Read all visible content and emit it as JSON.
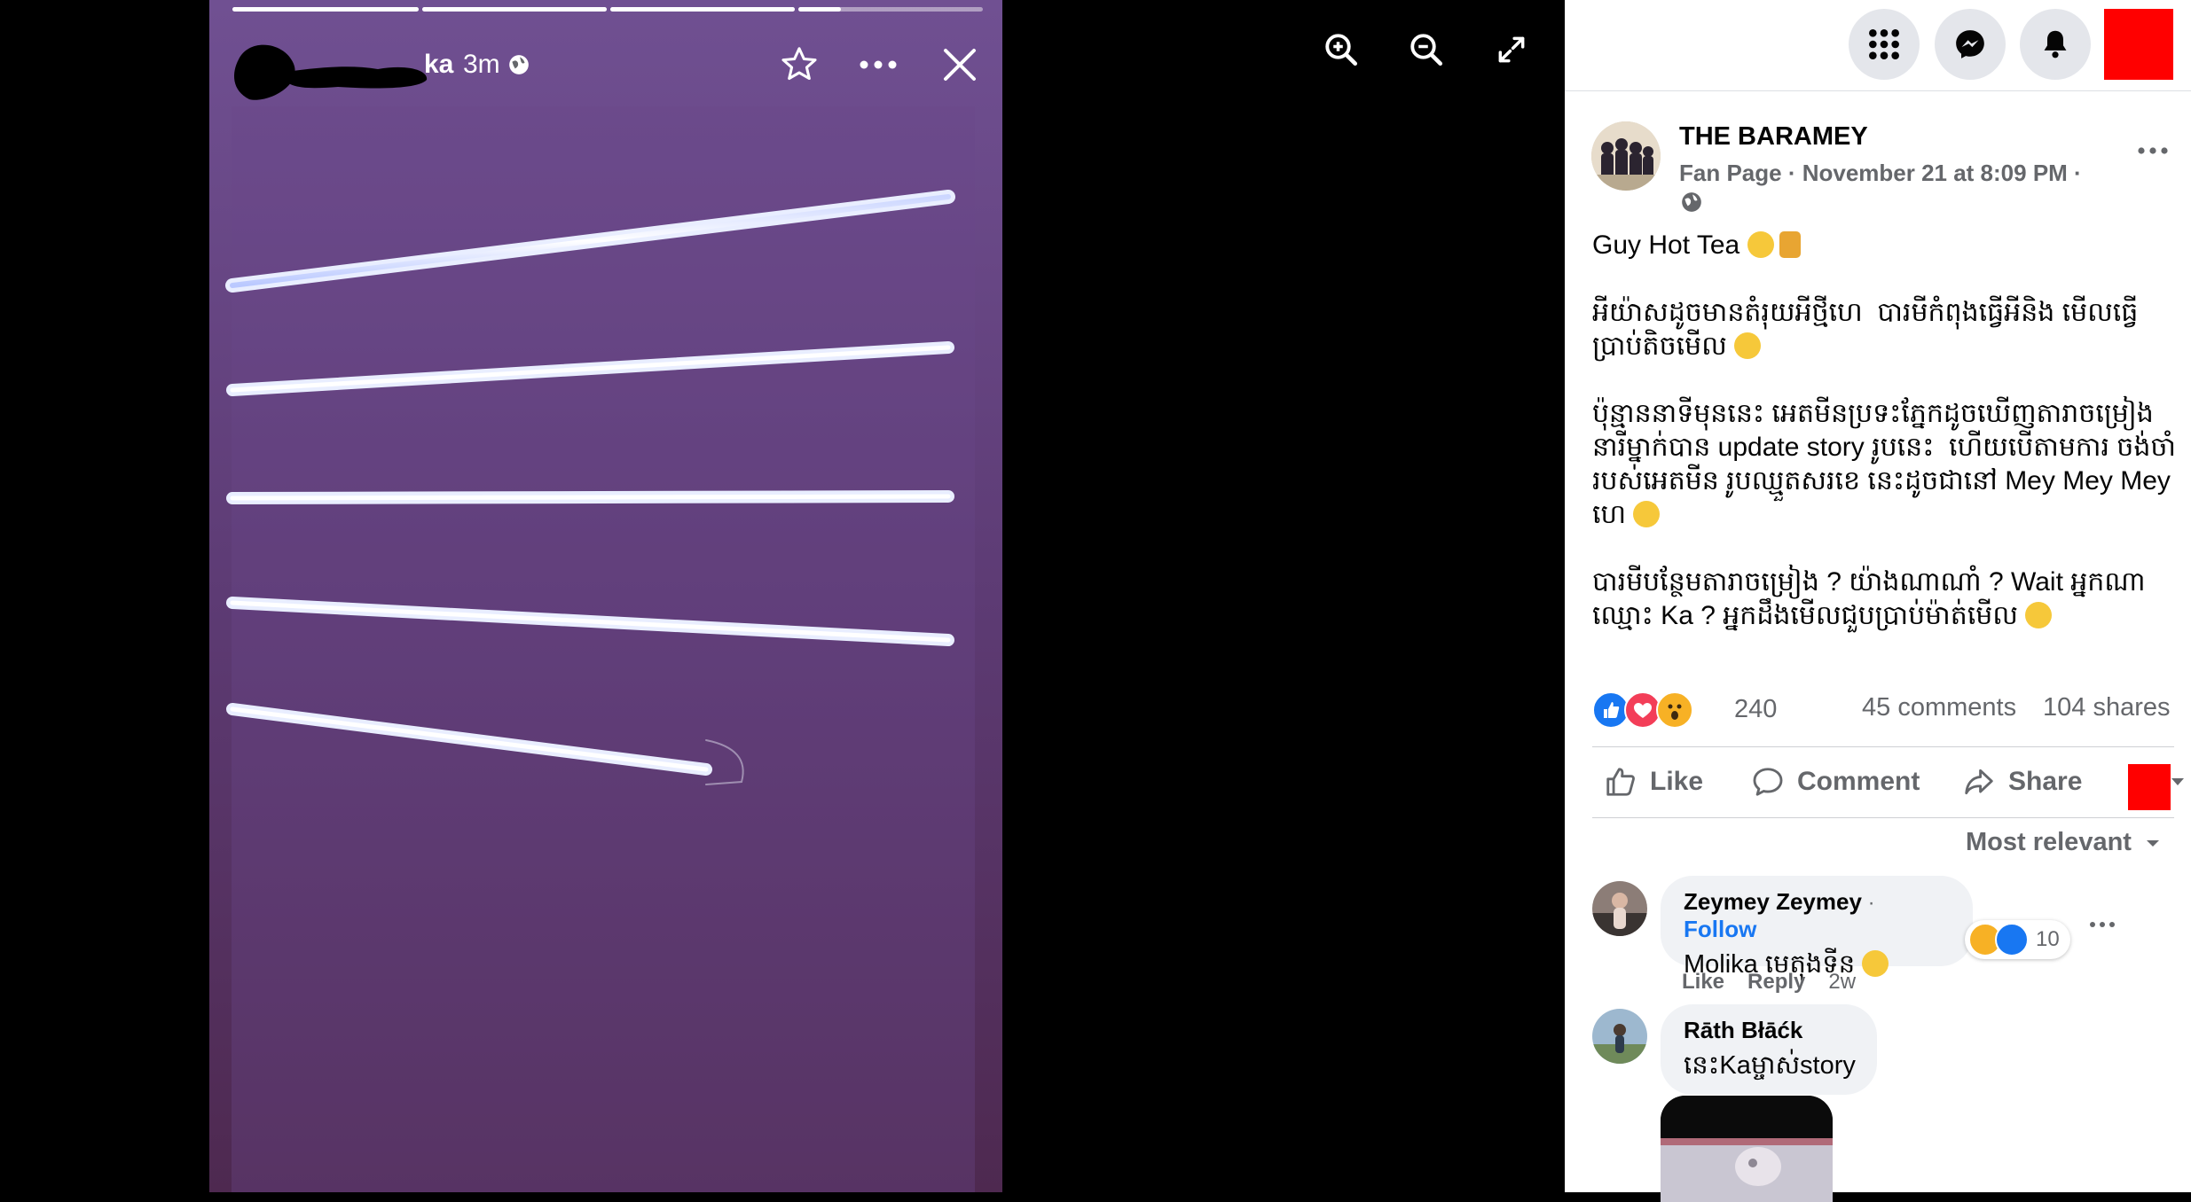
{
  "story": {
    "author": "ka",
    "time": "3m",
    "progress": [
      1,
      1,
      1,
      0.23,
      0
    ]
  },
  "viewer_tools": [
    "zoom-in",
    "zoom-out",
    "fullscreen"
  ],
  "post": {
    "page_name": "THE BARAMEY",
    "page_meta": "Fan Page · November 21 at 8:09 PM ·",
    "paragraphs": [
      "Guy Hot Tea",
      "អីយ៉ាសដូចមានតំរុយអីថ្មីហេ  បារមីកំពុងធ្វើអីនិង មើលធ្វើ ប្រាប់តិចមើល",
      "ប៉ុន្មាននាទីមុននេះ អេតមីនប្រទះភ្នែកដូចឃើញតារាចម្រៀង នារីម្នាក់បាន update story រូបនេះ  ហើយបើតាមការ ចង់ចាំរបស់អេតមីន រូបឈ្មួតសរខេ នេះដូចជានៅ Mey Mey Mey ហេ",
      "បារមីបន្ថែមតារាចម្រៀង ? យ៉ាងណាណាំ ? Wait អ្នកណា ឈ្មោះ Ka ? អ្នកដឹងមើលជួបប្រាប់ម៉ាត់មើល"
    ],
    "reaction_count": "240",
    "comments_count": "45 comments",
    "shares_count": "104 shares",
    "actions": {
      "like": "Like",
      "comment": "Comment",
      "share": "Share"
    },
    "sort_label": "Most relevant"
  },
  "comments": [
    {
      "name": "Zeymey Zeymey",
      "follow": "Follow",
      "text": "Molika មេតុងទីន",
      "reaction_count": "10",
      "like": "Like",
      "reply": "Reply",
      "age": "2w"
    },
    {
      "name": "Rāth Błāćk",
      "text": "នេះKaម្ចាស់story"
    }
  ],
  "colors": {
    "accent": "#1877f2",
    "redaction": "#ff0000",
    "story_bg": "#5e3d78"
  }
}
